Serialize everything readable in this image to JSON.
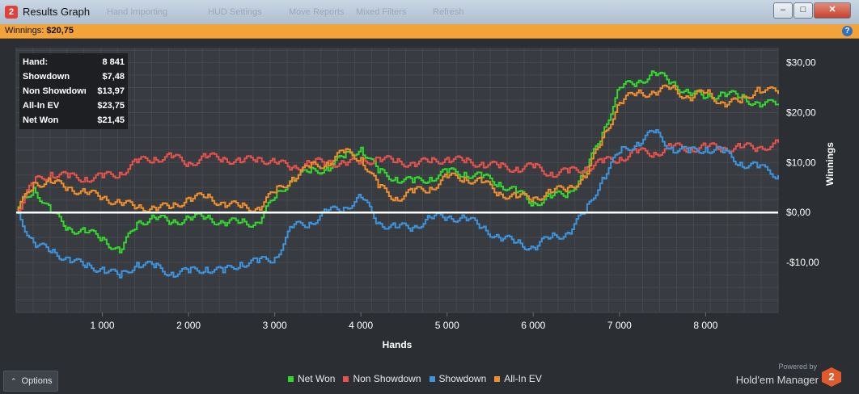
{
  "window": {
    "title": "Results Graph",
    "app_icon": "2",
    "ghost_toolbar": [
      "Hand Importing",
      "HUD Settings",
      "Move Reports",
      "Mixed Filters",
      "Refresh"
    ],
    "minimize": "–",
    "maximize": "□",
    "close": "✕"
  },
  "winnings_bar": {
    "label": "Winnings:",
    "value": "$20,75",
    "help": "?"
  },
  "stats": [
    {
      "label": "Hand:",
      "value": "8 841"
    },
    {
      "label": "Showdown",
      "value": "$7,48"
    },
    {
      "label": "Non Showdown",
      "value": "$13,97"
    },
    {
      "label": "All-In EV",
      "value": "$23,75"
    },
    {
      "label": "Net Won",
      "value": "$21,45"
    }
  ],
  "chart_data": {
    "type": "line",
    "xlabel": "Hands",
    "ylabel": "Winnings",
    "xlim": [
      0,
      8841
    ],
    "ylim": [
      -20,
      33
    ],
    "x_ticks": [
      1000,
      2000,
      3000,
      4000,
      5000,
      6000,
      7000,
      8000
    ],
    "x_tick_labels": [
      "1 000",
      "2 000",
      "3 000",
      "4 000",
      "5 000",
      "6 000",
      "7 000",
      "8 000"
    ],
    "y_ticks": [
      30,
      20,
      10,
      0,
      -10
    ],
    "y_tick_labels": [
      "$30,00",
      "$20,00",
      "$10,00",
      "$0,00",
      "-$10,00"
    ],
    "x": [
      0,
      200,
      400,
      600,
      800,
      1000,
      1200,
      1400,
      1600,
      1800,
      2000,
      2200,
      2400,
      2600,
      2800,
      3000,
      3200,
      3400,
      3600,
      3800,
      4000,
      4200,
      4400,
      4600,
      4800,
      5000,
      5200,
      5400,
      5600,
      5800,
      6000,
      6200,
      6400,
      6600,
      6800,
      7000,
      7200,
      7400,
      7600,
      7800,
      8000,
      8200,
      8400,
      8600,
      8841
    ],
    "series": [
      {
        "name": "Net Won",
        "color": "#33d82e",
        "values": [
          0,
          5,
          0,
          -3,
          -4,
          -5,
          -8,
          -2,
          -1,
          -2,
          -1,
          -1,
          -2,
          -2,
          -2,
          3,
          7,
          8,
          9,
          11,
          13,
          8,
          7,
          6,
          7,
          8,
          8,
          7,
          6,
          4,
          2,
          3,
          4,
          8,
          16,
          25,
          26,
          28,
          26,
          24,
          23,
          24,
          23,
          22,
          21.45
        ]
      },
      {
        "name": "Non Showdown",
        "color": "#e8524d",
        "values": [
          0,
          6,
          8,
          7,
          7,
          7,
          8,
          10,
          11,
          11,
          10,
          11,
          11,
          10,
          11,
          10,
          9,
          10,
          10,
          10,
          10,
          11,
          10,
          10,
          10,
          11,
          10,
          10,
          9,
          9,
          9,
          8,
          8,
          9,
          10,
          11,
          12,
          12,
          13,
          13,
          13,
          13,
          13,
          13,
          13.97
        ]
      },
      {
        "name": "Showdown",
        "color": "#3d94dd",
        "values": [
          0,
          -6,
          -8,
          -9,
          -11,
          -11,
          -13,
          -10,
          -11,
          -12,
          -12,
          -11,
          -12,
          -10,
          -10,
          -9,
          -3,
          -2,
          0,
          1,
          3,
          -2,
          -3,
          -3,
          -1,
          -1,
          -1,
          -3,
          -5,
          -6,
          -7,
          -5,
          -4,
          0,
          7,
          12,
          14,
          16,
          13,
          12,
          13,
          12,
          10,
          9,
          7.48
        ]
      },
      {
        "name": "All-In EV",
        "color": "#ef8e2c",
        "values": [
          0,
          6,
          6,
          5,
          4,
          3,
          2,
          1,
          1,
          1,
          3,
          3,
          2,
          1,
          1,
          4,
          7,
          9,
          10,
          12,
          11,
          5,
          3,
          4,
          5,
          7,
          7,
          6,
          4,
          3,
          3,
          4,
          5,
          7,
          15,
          22,
          24,
          24,
          25,
          23,
          24,
          22,
          22,
          25,
          23.75
        ]
      }
    ],
    "zero_line": true,
    "grid": true,
    "legend_position": "bottom-center"
  },
  "bottom": {
    "options_label": "Options",
    "powered_by": "Powered by",
    "brand": "Hold'em Manager",
    "brand_logo": "2"
  }
}
